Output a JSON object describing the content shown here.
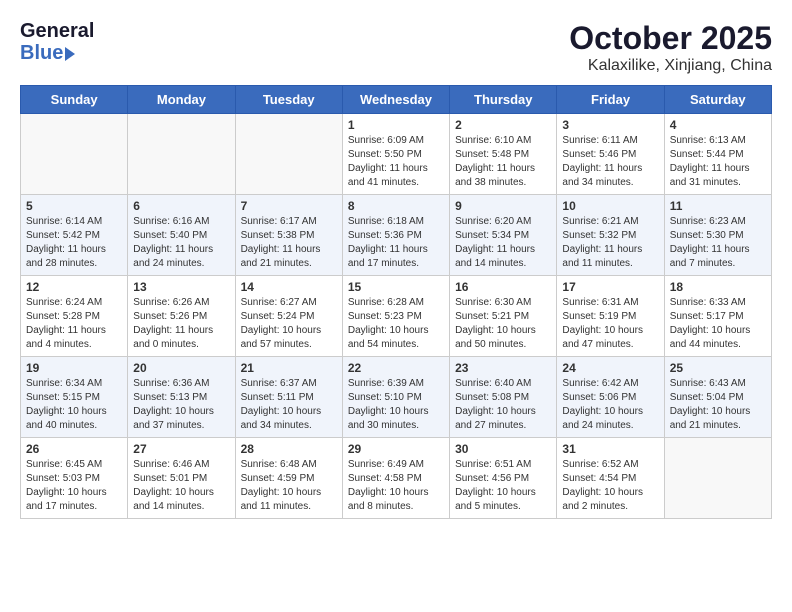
{
  "header": {
    "logo_general": "General",
    "logo_blue": "Blue",
    "month": "October 2025",
    "location": "Kalaxilike, Xinjiang, China"
  },
  "weekdays": [
    "Sunday",
    "Monday",
    "Tuesday",
    "Wednesday",
    "Thursday",
    "Friday",
    "Saturday"
  ],
  "weeks": [
    [
      {
        "day": "",
        "sunrise": "",
        "sunset": "",
        "daylight": ""
      },
      {
        "day": "",
        "sunrise": "",
        "sunset": "",
        "daylight": ""
      },
      {
        "day": "",
        "sunrise": "",
        "sunset": "",
        "daylight": ""
      },
      {
        "day": "1",
        "sunrise": "Sunrise: 6:09 AM",
        "sunset": "Sunset: 5:50 PM",
        "daylight": "Daylight: 11 hours and 41 minutes."
      },
      {
        "day": "2",
        "sunrise": "Sunrise: 6:10 AM",
        "sunset": "Sunset: 5:48 PM",
        "daylight": "Daylight: 11 hours and 38 minutes."
      },
      {
        "day": "3",
        "sunrise": "Sunrise: 6:11 AM",
        "sunset": "Sunset: 5:46 PM",
        "daylight": "Daylight: 11 hours and 34 minutes."
      },
      {
        "day": "4",
        "sunrise": "Sunrise: 6:13 AM",
        "sunset": "Sunset: 5:44 PM",
        "daylight": "Daylight: 11 hours and 31 minutes."
      }
    ],
    [
      {
        "day": "5",
        "sunrise": "Sunrise: 6:14 AM",
        "sunset": "Sunset: 5:42 PM",
        "daylight": "Daylight: 11 hours and 28 minutes."
      },
      {
        "day": "6",
        "sunrise": "Sunrise: 6:16 AM",
        "sunset": "Sunset: 5:40 PM",
        "daylight": "Daylight: 11 hours and 24 minutes."
      },
      {
        "day": "7",
        "sunrise": "Sunrise: 6:17 AM",
        "sunset": "Sunset: 5:38 PM",
        "daylight": "Daylight: 11 hours and 21 minutes."
      },
      {
        "day": "8",
        "sunrise": "Sunrise: 6:18 AM",
        "sunset": "Sunset: 5:36 PM",
        "daylight": "Daylight: 11 hours and 17 minutes."
      },
      {
        "day": "9",
        "sunrise": "Sunrise: 6:20 AM",
        "sunset": "Sunset: 5:34 PM",
        "daylight": "Daylight: 11 hours and 14 minutes."
      },
      {
        "day": "10",
        "sunrise": "Sunrise: 6:21 AM",
        "sunset": "Sunset: 5:32 PM",
        "daylight": "Daylight: 11 hours and 11 minutes."
      },
      {
        "day": "11",
        "sunrise": "Sunrise: 6:23 AM",
        "sunset": "Sunset: 5:30 PM",
        "daylight": "Daylight: 11 hours and 7 minutes."
      }
    ],
    [
      {
        "day": "12",
        "sunrise": "Sunrise: 6:24 AM",
        "sunset": "Sunset: 5:28 PM",
        "daylight": "Daylight: 11 hours and 4 minutes."
      },
      {
        "day": "13",
        "sunrise": "Sunrise: 6:26 AM",
        "sunset": "Sunset: 5:26 PM",
        "daylight": "Daylight: 11 hours and 0 minutes."
      },
      {
        "day": "14",
        "sunrise": "Sunrise: 6:27 AM",
        "sunset": "Sunset: 5:24 PM",
        "daylight": "Daylight: 10 hours and 57 minutes."
      },
      {
        "day": "15",
        "sunrise": "Sunrise: 6:28 AM",
        "sunset": "Sunset: 5:23 PM",
        "daylight": "Daylight: 10 hours and 54 minutes."
      },
      {
        "day": "16",
        "sunrise": "Sunrise: 6:30 AM",
        "sunset": "Sunset: 5:21 PM",
        "daylight": "Daylight: 10 hours and 50 minutes."
      },
      {
        "day": "17",
        "sunrise": "Sunrise: 6:31 AM",
        "sunset": "Sunset: 5:19 PM",
        "daylight": "Daylight: 10 hours and 47 minutes."
      },
      {
        "day": "18",
        "sunrise": "Sunrise: 6:33 AM",
        "sunset": "Sunset: 5:17 PM",
        "daylight": "Daylight: 10 hours and 44 minutes."
      }
    ],
    [
      {
        "day": "19",
        "sunrise": "Sunrise: 6:34 AM",
        "sunset": "Sunset: 5:15 PM",
        "daylight": "Daylight: 10 hours and 40 minutes."
      },
      {
        "day": "20",
        "sunrise": "Sunrise: 6:36 AM",
        "sunset": "Sunset: 5:13 PM",
        "daylight": "Daylight: 10 hours and 37 minutes."
      },
      {
        "day": "21",
        "sunrise": "Sunrise: 6:37 AM",
        "sunset": "Sunset: 5:11 PM",
        "daylight": "Daylight: 10 hours and 34 minutes."
      },
      {
        "day": "22",
        "sunrise": "Sunrise: 6:39 AM",
        "sunset": "Sunset: 5:10 PM",
        "daylight": "Daylight: 10 hours and 30 minutes."
      },
      {
        "day": "23",
        "sunrise": "Sunrise: 6:40 AM",
        "sunset": "Sunset: 5:08 PM",
        "daylight": "Daylight: 10 hours and 27 minutes."
      },
      {
        "day": "24",
        "sunrise": "Sunrise: 6:42 AM",
        "sunset": "Sunset: 5:06 PM",
        "daylight": "Daylight: 10 hours and 24 minutes."
      },
      {
        "day": "25",
        "sunrise": "Sunrise: 6:43 AM",
        "sunset": "Sunset: 5:04 PM",
        "daylight": "Daylight: 10 hours and 21 minutes."
      }
    ],
    [
      {
        "day": "26",
        "sunrise": "Sunrise: 6:45 AM",
        "sunset": "Sunset: 5:03 PM",
        "daylight": "Daylight: 10 hours and 17 minutes."
      },
      {
        "day": "27",
        "sunrise": "Sunrise: 6:46 AM",
        "sunset": "Sunset: 5:01 PM",
        "daylight": "Daylight: 10 hours and 14 minutes."
      },
      {
        "day": "28",
        "sunrise": "Sunrise: 6:48 AM",
        "sunset": "Sunset: 4:59 PM",
        "daylight": "Daylight: 10 hours and 11 minutes."
      },
      {
        "day": "29",
        "sunrise": "Sunrise: 6:49 AM",
        "sunset": "Sunset: 4:58 PM",
        "daylight": "Daylight: 10 hours and 8 minutes."
      },
      {
        "day": "30",
        "sunrise": "Sunrise: 6:51 AM",
        "sunset": "Sunset: 4:56 PM",
        "daylight": "Daylight: 10 hours and 5 minutes."
      },
      {
        "day": "31",
        "sunrise": "Sunrise: 6:52 AM",
        "sunset": "Sunset: 4:54 PM",
        "daylight": "Daylight: 10 hours and 2 minutes."
      },
      {
        "day": "",
        "sunrise": "",
        "sunset": "",
        "daylight": ""
      }
    ]
  ]
}
